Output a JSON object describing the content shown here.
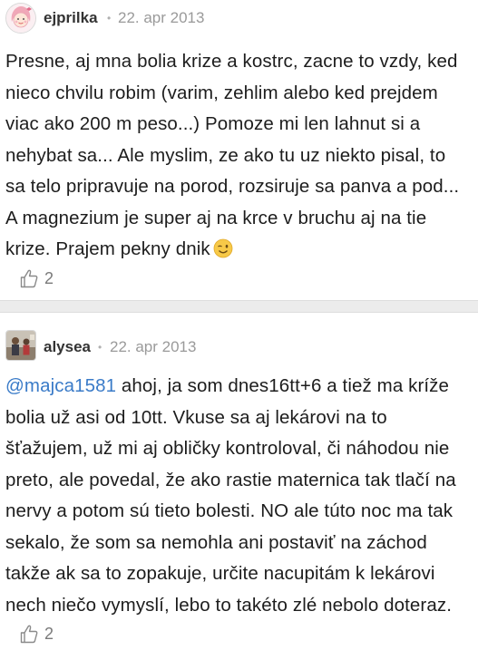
{
  "comments": [
    {
      "author": "ejprilka",
      "separator": "•",
      "date": "22. apr 2013",
      "avatar_icon": "girl-face-avatar-icon",
      "text": "Presne, aj mna bolia krize a kostrc, zacne to vzdy, ked nieco chvilu robim (varim, zehlim alebo ked prejdem viac ako 200 m peso...) Pomoze mi len lahnut si a nehybat sa... Ale myslim, ze ako tu uz niekto pisal, to sa telo pripravuje na porod, rozsiruje sa panva a pod... A magnezium je super aj na krce v bruchu aj na tie krize. Prajem pekny dnik",
      "emoji": "winking-face-emoji",
      "likes": "2",
      "like_icon": "thumbs-up-icon"
    },
    {
      "author": "alysea",
      "separator": "•",
      "date": "22. apr 2013",
      "avatar_icon": "photo-avatar-icon",
      "mention": "@majca1581",
      "text": " ahoj, ja som dnes16tt+6 a tiež ma kríže bolia už asi od 10tt. Vkuse sa aj lekárovi na to šťažujem, už mi aj obličky kontroloval, či náhodou nie preto, ale povedal, že ako rastie maternica tak tlačí na nervy a potom sú tieto bolesti. NO ale túto noc ma tak sekalo, že som sa nemohla ani postaviť na záchod takže ak sa to zopakuje, určite nacupitám k lekárovi nech niečo vymyslí, lebo to takéto zlé nebolo doteraz.",
      "likes": "2",
      "like_icon": "thumbs-up-icon"
    }
  ],
  "colors": {
    "mention": "#3a7bc8",
    "author": "#333333",
    "date": "#9a9a9a",
    "divider": "#ececec"
  }
}
